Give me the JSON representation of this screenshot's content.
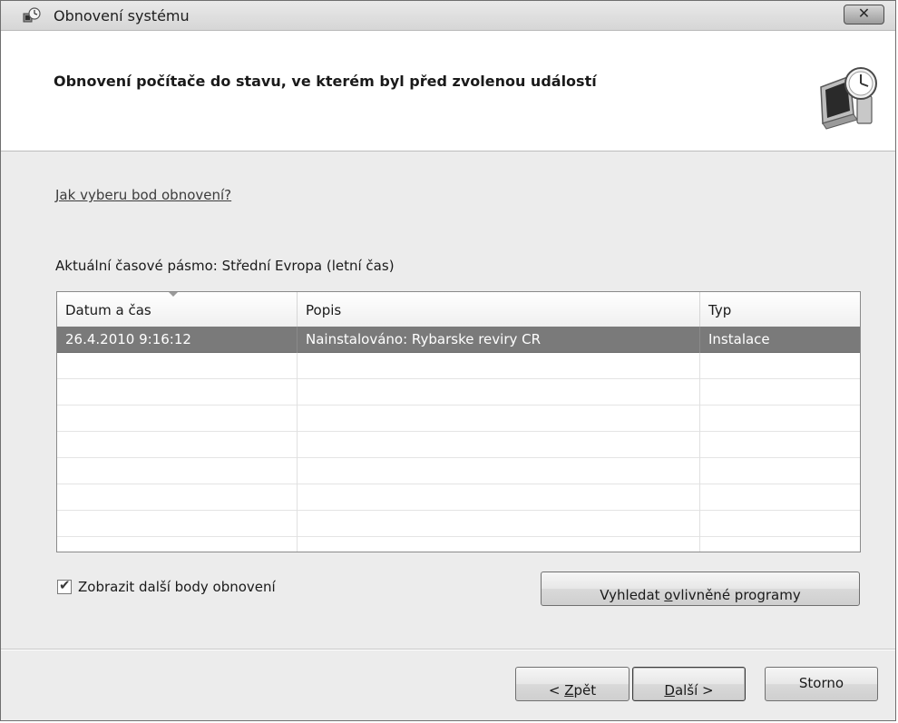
{
  "window": {
    "title": "Obnovení systému",
    "close_label": "✕"
  },
  "header": {
    "title": "Obnovení počítače do stavu, ve kterém byl před zvolenou událostí"
  },
  "body": {
    "help_link": "Jak vyberu bod obnovení?",
    "timezone_label": "Aktuální časové pásmo: Střední Evropa (letní čas)"
  },
  "table": {
    "columns": [
      "Datum a čas",
      "Popis",
      "Typ"
    ],
    "rows": [
      {
        "date": "26.4.2010 9:16:12",
        "description": "Nainstalováno: Rybarske reviry CR",
        "type": "Instalace",
        "selected": true
      }
    ]
  },
  "options": {
    "show_more_label": "Zobrazit další body obnovení",
    "show_more_checked": true
  },
  "buttons": {
    "affected_pre": "Vyhledat ",
    "affected_u": "o",
    "affected_post": "vlivněné programy",
    "back_pre": "< ",
    "back_u": "Z",
    "back_post": "pět",
    "next_u": "D",
    "next_post": "alší >",
    "cancel": "Storno"
  },
  "icons": {
    "title_icon": "system-restore-icon",
    "header_art": "system-restore-clock-monitor-icon"
  }
}
